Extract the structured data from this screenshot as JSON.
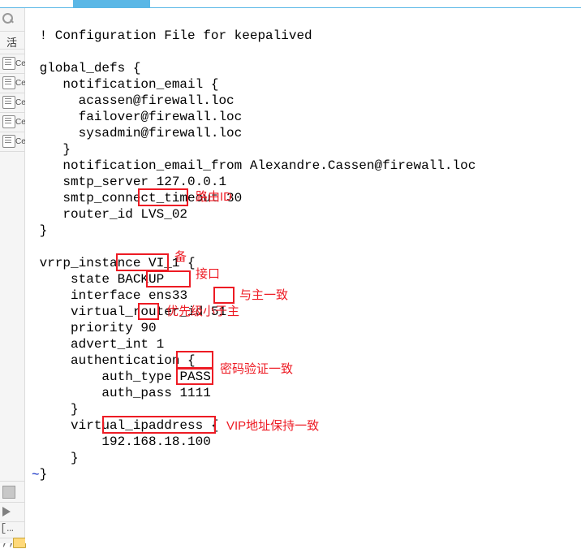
{
  "gutter": {
    "word": "活",
    "tab_letter": "Ce"
  },
  "config": {
    "line0": " ! Configuration File for keepalived",
    "blank": "",
    "global_open": " global_defs {",
    "notif_open": "    notification_email {",
    "email1": "      acassen@firewall.loc",
    "email2": "      failover@firewall.loc",
    "email3": "      sysadmin@firewall.loc",
    "notif_close": "    }",
    "notif_from": "    notification_email_from Alexandre.Cassen@firewall.loc",
    "smtp_server": "    smtp_server 127.0.0.1",
    "smtp_timeout": "    smtp_connect_timeout 30",
    "router_pre": "    router_id ",
    "router_val": "LVS_02",
    "global_close": " }",
    "vrrp_open": " vrrp_instance VI_1 {",
    "state_pre": "     state ",
    "state_val": "BACKUP",
    "iface_pre": "     interface ",
    "iface_val": "ens33",
    "vrid_pre": "     virtual_router_id ",
    "vrid_val": "51",
    "prio_pre": "     priority ",
    "prio_val": "90",
    "advert": "     advert_int 1",
    "auth_open": "     authentication {",
    "authtype_pre": "         auth_type ",
    "authtype_val": "PASS",
    "authpass_pre": "         auth_pass ",
    "authpass_val": "1111",
    "auth_close": "     }",
    "vip_open": "     virtual_ipaddress {",
    "vip_pre": "         ",
    "vip_val": "192.168.18.100",
    "vip_close": "     }",
    "vrrp_close": " }"
  },
  "notes": {
    "router": "路由ID",
    "backup": "备",
    "iface": "接口",
    "vrid": "与主一致",
    "prio": "优先级小于主",
    "auth": "密码验证一致",
    "vip": "VIP地址保持一致"
  }
}
